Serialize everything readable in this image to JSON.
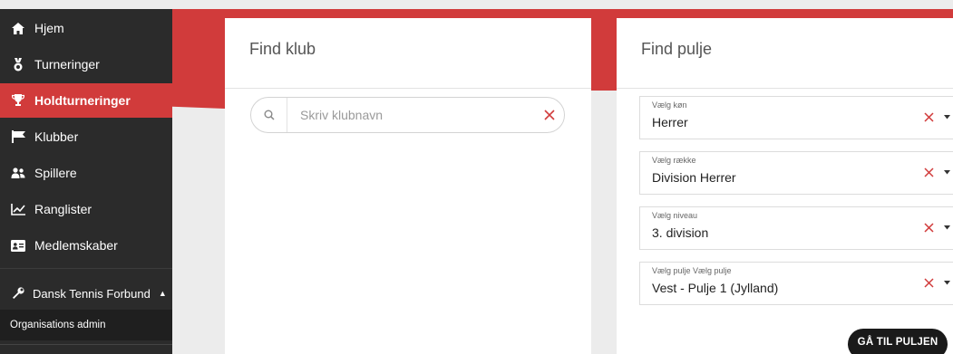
{
  "sidebar": {
    "items": [
      {
        "label": "Hjem",
        "icon": "home-icon"
      },
      {
        "label": "Turneringer",
        "icon": "medal-icon"
      },
      {
        "label": "Holdturneringer",
        "icon": "trophy-icon",
        "active": true
      },
      {
        "label": "Klubber",
        "icon": "flag-icon"
      },
      {
        "label": "Spillere",
        "icon": "users-icon"
      },
      {
        "label": "Ranglister",
        "icon": "chart-icon"
      },
      {
        "label": "Medlemskaber",
        "icon": "id-card-icon"
      }
    ],
    "org": {
      "label": "Dansk Tennis Forbund",
      "icon": "wrench-icon"
    },
    "org_admin": "Organisations admin"
  },
  "find_klub": {
    "title": "Find klub",
    "search_placeholder": "Skriv klubnavn",
    "search_value": ""
  },
  "find_pulje": {
    "title": "Find pulje",
    "selects": [
      {
        "label": "Vælg køn",
        "value": "Herrer"
      },
      {
        "label": "Vælg række",
        "value": "Division Herrer"
      },
      {
        "label": "Vælg niveau",
        "value": "3. division"
      },
      {
        "label": "Vælg pulje Vælg pulje",
        "value": "Vest - Pulje 1 (Jylland)"
      }
    ],
    "button_label": "GÅ TIL PULJEN"
  },
  "colors": {
    "accent": "#d13b3b",
    "sidebar": "#2b2b2b",
    "button": "#1a1a1a"
  }
}
